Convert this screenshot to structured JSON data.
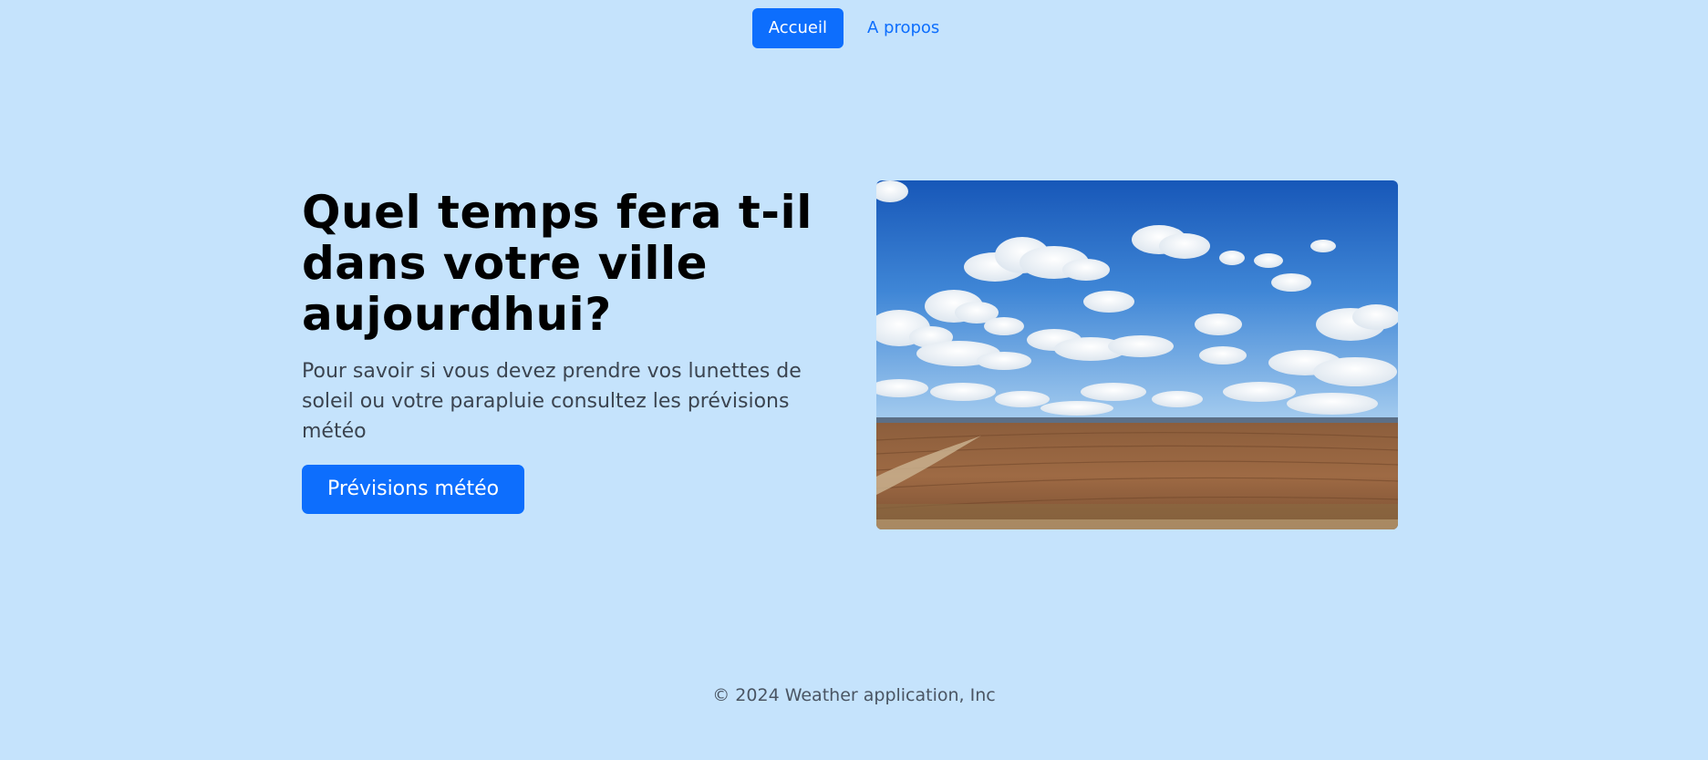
{
  "nav": {
    "items": [
      {
        "label": "Accueil",
        "active": true
      },
      {
        "label": "A propos",
        "active": false
      }
    ]
  },
  "hero": {
    "title": "Quel temps fera t-il dans votre ville aujourdhui?",
    "lead": "Pour savoir si vous devez prendre vos lunettes de soleil ou votre parapluie consultez les prévisions météo",
    "cta_label": "Prévisions météo",
    "image_icon": "landscape-sky-clouds-field-photo"
  },
  "footer": {
    "text": "© 2024 Weather application, Inc"
  },
  "colors": {
    "background": "#c5e3fc",
    "primary": "#0d6efd",
    "text_dark": "#000000",
    "text_muted": "#3b4450"
  }
}
